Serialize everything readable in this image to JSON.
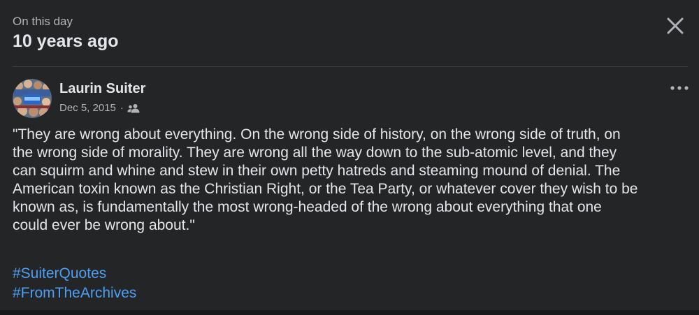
{
  "header": {
    "subtitle": "On this day",
    "title": "10 years ago"
  },
  "post": {
    "author": "Laurin Suiter",
    "date": "Dec 5, 2015",
    "separator": "·",
    "audience_icon": "friends-icon",
    "text": "\"They are wrong about everything. On the wrong side of history, on the wrong side of truth, on\nthe wrong side of morality. They are wrong all the way down to the sub-atomic level, and they\ncan squirm and whine and stew in their own petty hatreds and steaming mound of denial. The\nAmerican toxin known as the Christian Right, or the Tea Party, or whatever cover they wish to be\nknown as, is fundamentally the most wrong-headed of the wrong about everything that one\ncould ever be wrong about.\"",
    "hashtags": [
      "#SuiterQuotes",
      "#FromTheArchives"
    ]
  },
  "colors": {
    "background": "#242526",
    "primary_text": "#e4e6eb",
    "secondary_text": "#b0b3b8",
    "link": "#4d9ef5",
    "divider": "#3e4042"
  }
}
